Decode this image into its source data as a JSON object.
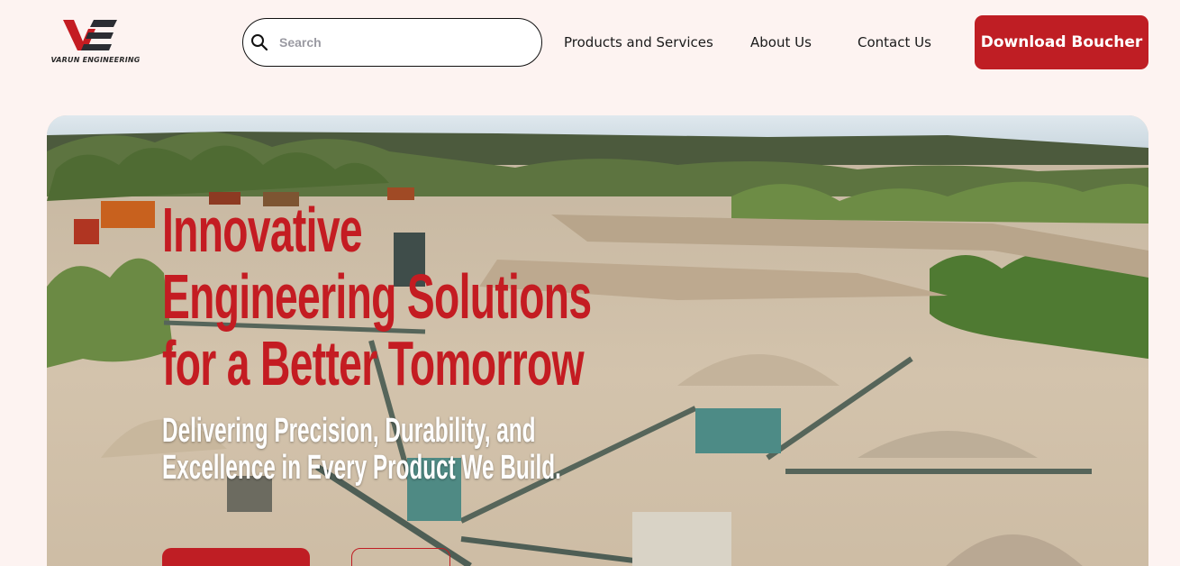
{
  "brand": {
    "name": "VARUN ENGINEERING",
    "logo_icon": "ve-logo-icon",
    "accent_color": "#bf1e24"
  },
  "search": {
    "placeholder": "Search",
    "value": "",
    "icon": "search-icon"
  },
  "nav": {
    "items": [
      {
        "label": "Products and Services"
      },
      {
        "label": "About Us"
      },
      {
        "label": "Contact Us"
      }
    ],
    "download_label": "Download Boucher"
  },
  "hero": {
    "title_lines": [
      "Innovative",
      "Engineering Solutions",
      "for a Better Tomorrow"
    ],
    "subtitle_lines": [
      "Delivering Precision, Durability, and",
      "Excellence in Every Product We Build."
    ],
    "title_color": "#c41c22",
    "subtitle_color": "#ffffff",
    "background": "quarry-crushing-plant-aerial-photo"
  }
}
